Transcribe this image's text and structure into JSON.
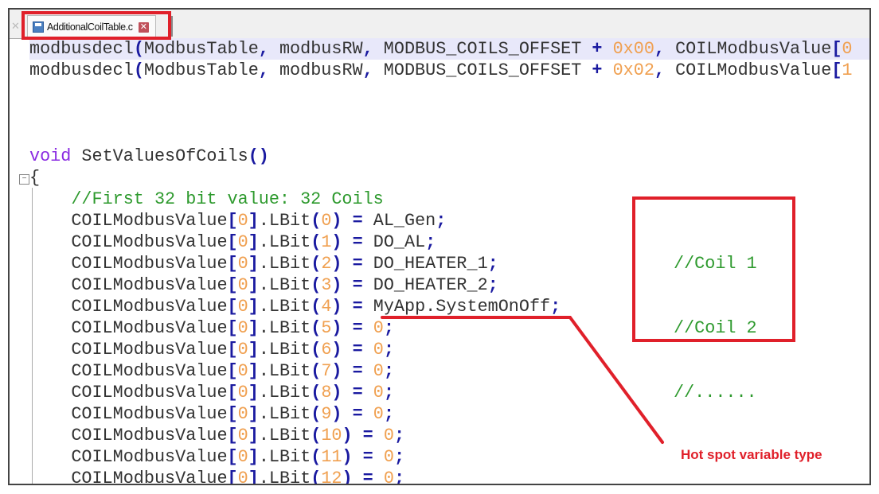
{
  "tab": {
    "filename": "AdditionalCoilTable.c",
    "close_glyph": "✕",
    "scroll_glyph": "✕"
  },
  "code_lines": [
    "modbusdecl(ModbusTable, modbusRW, MODBUS_COILS_OFFSET + 0x00, COILModbusValue[0",
    "modbusdecl(ModbusTable, modbusRW, MODBUS_COILS_OFFSET + 0x02, COILModbusValue[1",
    "",
    "",
    "",
    "void SetValuesOfCoils()",
    "{",
    "    //First 32 bit value: 32 Coils",
    "    COILModbusValue[0].LBit(0) = AL_Gen;",
    "    COILModbusValue[0].LBit(1) = DO_AL;",
    "    COILModbusValue[0].LBit(2) = DO_HEATER_1;",
    "    COILModbusValue[0].LBit(3) = DO_HEATER_2;",
    "    COILModbusValue[0].LBit(4) = MyApp.SystemOnOff;",
    "    COILModbusValue[0].LBit(5) = 0;",
    "    COILModbusValue[0].LBit(6) = 0;",
    "    COILModbusValue[0].LBit(7) = 0;",
    "    COILModbusValue[0].LBit(8) = 0;",
    "    COILModbusValue[0].LBit(9) = 0;",
    "    COILModbusValue[0].LBit(10) = 0;",
    "    COILModbusValue[0].LBit(11) = 0;",
    "    COILModbusValue[0].LBit(12) = 0;"
  ],
  "side_comments": [
    "//Coil 1",
    "//Coil 2",
    "//......"
  ],
  "annotation": {
    "text": "Hot spot variable type",
    "color": "#e0202a"
  },
  "colors": {
    "keyword": "#8a2be2",
    "operator": "#1a1aa0",
    "number": "#f0a050",
    "comment": "#2e9a2e",
    "highlight": "#e8e8fa"
  }
}
